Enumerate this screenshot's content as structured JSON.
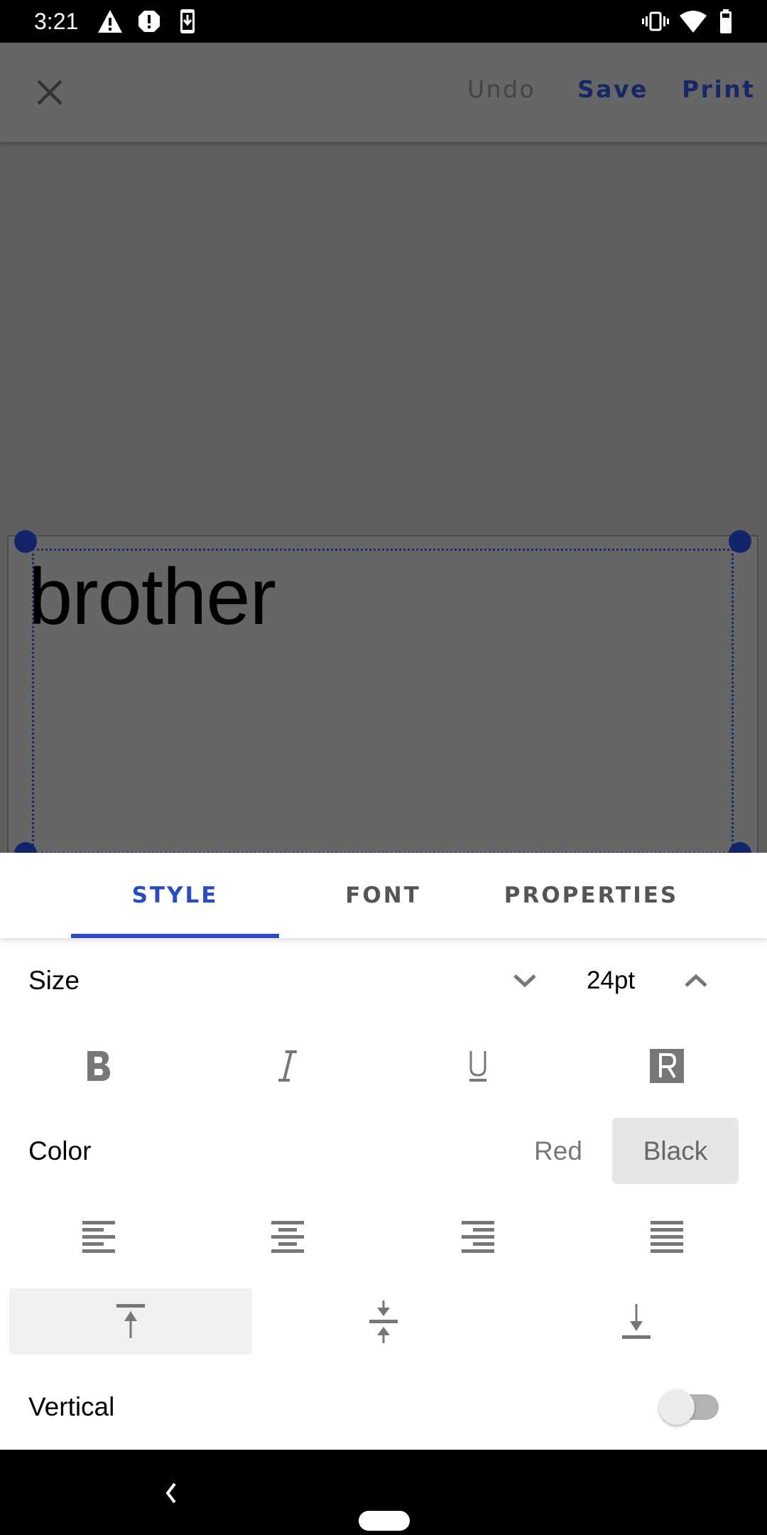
{
  "status_bar": {
    "time": "3:21",
    "left_icons": [
      "warning-icon",
      "alert-octagon-icon",
      "download-phone-icon"
    ],
    "right_icons": [
      "vibrate-icon",
      "wifi-icon",
      "battery-icon"
    ]
  },
  "toolbar": {
    "close_icon": "close-icon",
    "undo_label": "Undo",
    "save_label": "Save",
    "print_label": "Print"
  },
  "canvas": {
    "label_text": "brother"
  },
  "tabs": [
    {
      "label": "STYLE",
      "active": true
    },
    {
      "label": "FONT",
      "active": false
    },
    {
      "label": "PROPERTIES",
      "active": false
    }
  ],
  "style_panel": {
    "size": {
      "label": "Size",
      "value": "24pt",
      "decrease_icon": "chevron-down-icon",
      "increase_icon": "chevron-up-icon"
    },
    "text_styles": [
      "bold-icon",
      "italic-icon",
      "underline-icon",
      "inverted-r-icon"
    ],
    "color": {
      "label": "Color",
      "options": [
        "Red",
        "Black"
      ],
      "selected": "Black"
    },
    "horizontal_alignment": [
      "align-left-icon",
      "align-center-icon",
      "align-right-icon",
      "align-justify-icon"
    ],
    "vertical_alignment": {
      "options": [
        "align-top-icon",
        "align-middle-icon",
        "align-bottom-icon"
      ],
      "selected": "align-top-icon"
    },
    "vertical": {
      "label": "Vertical",
      "enabled": false
    }
  },
  "colors": {
    "accent": "#2a4bc2",
    "toolbar_action": "#182766",
    "selection_handle": "#14246a",
    "overlay": "#666666"
  },
  "nav_bar": {
    "back_icon": "back-icon",
    "home_icon": "home-pill-icon"
  }
}
